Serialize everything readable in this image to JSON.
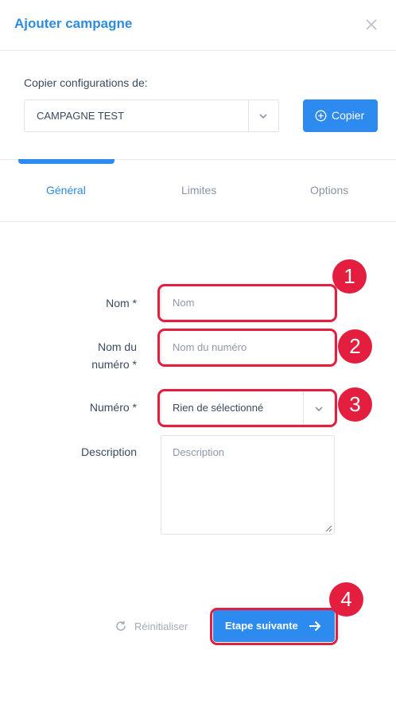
{
  "dialog": {
    "title": "Ajouter campagne"
  },
  "copy": {
    "label": "Copier configurations de:",
    "selected": "CAMPAGNE TEST",
    "button_label": "Copier"
  },
  "tabs": [
    {
      "label": "Général",
      "active": true
    },
    {
      "label": "Limites",
      "active": false
    },
    {
      "label": "Options",
      "active": false
    }
  ],
  "form": {
    "nom": {
      "label": "Nom *",
      "placeholder": "Nom"
    },
    "nom_numero": {
      "label_line1": "Nom du",
      "label_line2": "numéro *",
      "placeholder": "Nom du numéro"
    },
    "numero": {
      "label": "Numéro *",
      "selected": "Rien de sélectionné"
    },
    "description": {
      "label": "Description",
      "placeholder": "Description"
    }
  },
  "annotations": [
    "1",
    "2",
    "3",
    "4"
  ],
  "footer": {
    "reset_label": "Réinitialiser",
    "next_label": "Etape suivante"
  },
  "colors": {
    "accent": "#2d8bf0",
    "highlight": "#e41e3f",
    "title": "#2d8be0"
  }
}
